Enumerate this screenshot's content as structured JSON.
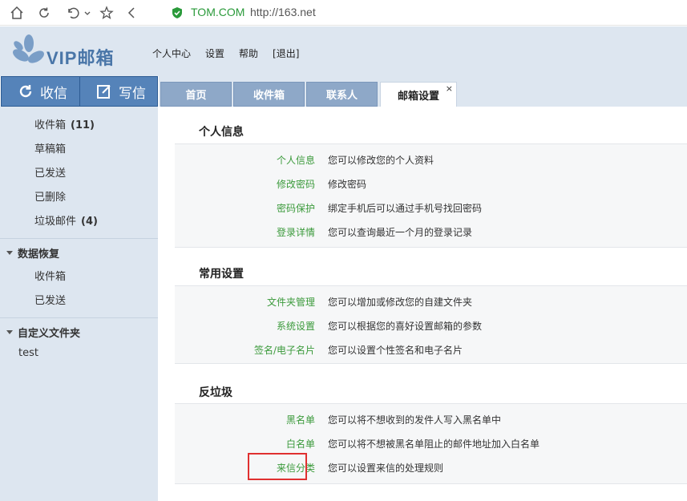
{
  "browser": {
    "url_domain": "TOM.COM",
    "url_rest": "http://163.net"
  },
  "header": {
    "logo_text": "VIP邮箱",
    "links": [
      "个人中心",
      "设置",
      "帮助",
      "[退出]"
    ]
  },
  "actions": {
    "receive": "收信",
    "write": "写信"
  },
  "tabs": [
    {
      "label": "首页"
    },
    {
      "label": "收件箱"
    },
    {
      "label": "联系人"
    },
    {
      "label": "邮箱设置",
      "close": "×"
    }
  ],
  "sidebar": {
    "folders": [
      {
        "label": "收件箱",
        "count": "(11)"
      },
      {
        "label": "草稿箱",
        "count": ""
      },
      {
        "label": "已发送",
        "count": ""
      },
      {
        "label": "已删除",
        "count": ""
      },
      {
        "label": "垃圾邮件",
        "count": "(4)"
      }
    ],
    "recovery_title": "数据恢复",
    "recovery_items": [
      "收件箱",
      "已发送"
    ],
    "custom_title": "自定义文件夹",
    "custom_items": [
      "test"
    ]
  },
  "settings": {
    "personal": {
      "title": "个人信息",
      "rows": [
        {
          "link": "个人信息",
          "desc": "您可以修改您的个人资料"
        },
        {
          "link": "修改密码",
          "desc": "修改密码"
        },
        {
          "link": "密码保护",
          "desc": "绑定手机后可以通过手机号找回密码"
        },
        {
          "link": "登录详情",
          "desc": "您可以查询最近一个月的登录记录"
        }
      ]
    },
    "common": {
      "title": "常用设置",
      "rows": [
        {
          "link": "文件夹管理",
          "desc": "您可以增加或修改您的自建文件夹"
        },
        {
          "link": "系统设置",
          "desc": "您可以根据您的喜好设置邮箱的参数"
        },
        {
          "link": "签名/电子名片",
          "desc": "您可以设置个性签名和电子名片"
        }
      ]
    },
    "antispam": {
      "title": "反垃圾",
      "rows": [
        {
          "link": "黑名单",
          "desc": "您可以将不想收到的发件人写入黑名单中"
        },
        {
          "link": "白名单",
          "desc": "您可以将不想被黑名单阻止的邮件地址加入白名单"
        },
        {
          "link": "来信分类",
          "desc": "您可以设置来信的处理规则"
        }
      ]
    }
  },
  "colors": {
    "link_green": "#3b9a3b",
    "accent_blue": "#5583b9",
    "highlight_red": "#e03030"
  }
}
